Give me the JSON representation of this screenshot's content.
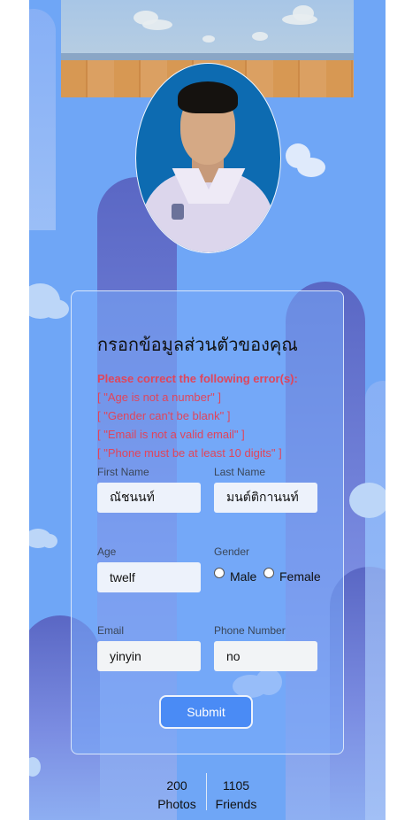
{
  "profile": {
    "stats": [
      {
        "value": "200",
        "label": "Photos"
      },
      {
        "value": "1105",
        "label": "Friends"
      }
    ]
  },
  "form": {
    "title": "กรอกข้อมูลส่วนตัวของคุณ",
    "error_heading": "Please correct the following error(s):",
    "errors": [
      "[ \"Age is not a number\" ]",
      "[ \"Gender can't be blank\" ]",
      "[ \"Email is not a valid email\" ]",
      "[ \"Phone must be at least 10 digits\" ]"
    ],
    "first_name": {
      "label": "First Name",
      "value": "ณัชนนท์"
    },
    "last_name": {
      "label": "Last Name",
      "value": "มนต์ติกานนท์"
    },
    "age": {
      "label": "Age",
      "value": "twelf"
    },
    "gender": {
      "label": "Gender",
      "options": [
        "Male",
        "Female"
      ]
    },
    "email": {
      "label": "Email",
      "value": "yinyin"
    },
    "phone": {
      "label": "Phone Number",
      "value": "no"
    },
    "submit_label": "Submit"
  },
  "colors": {
    "background": "#6fa6f6",
    "error": "#e0455b",
    "submit": "#4a8bf5"
  }
}
